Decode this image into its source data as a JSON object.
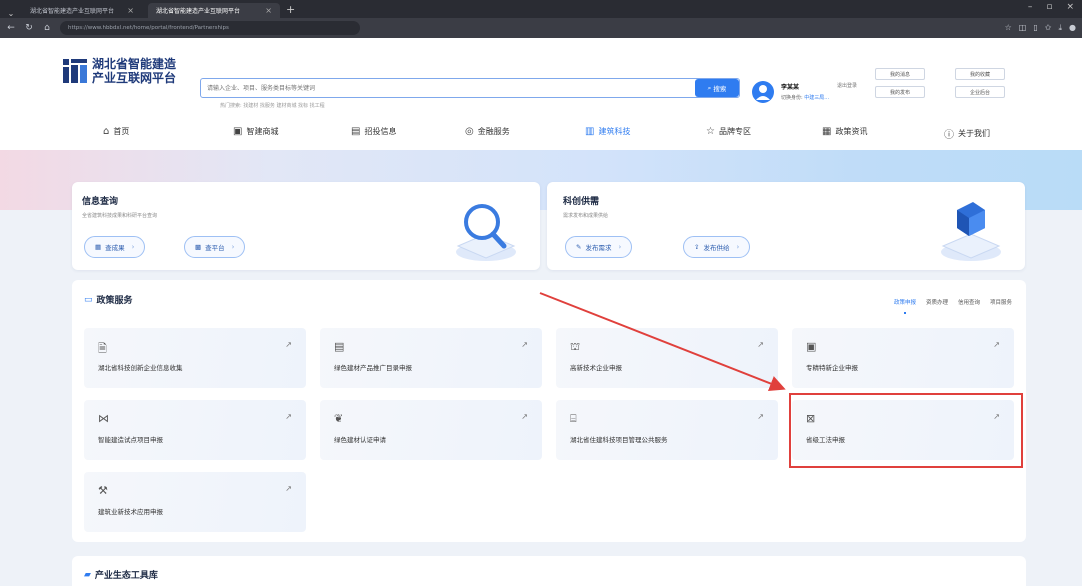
{
  "browser": {
    "tabs": [
      {
        "title": "湖北省智能建造产业互联网平台",
        "active": false
      },
      {
        "title": "湖北省智能建造产业互联网平台",
        "active": true
      }
    ],
    "new_tab": "+",
    "url": "https://www.hbbdxl.net/home/portal/frontend/Partnerships"
  },
  "site": {
    "logo_line1": "湖北省智能建造",
    "logo_line2": "产业互联网平台",
    "search_placeholder": "请输入企业、项目、服务类目标等关键词",
    "search_button": "搜索",
    "hot_words": "热门搜索: 找建材  找服务  建材商城  找标  找工程",
    "user": {
      "name": "李某某",
      "link": "退出登录",
      "role_prefix": "切换身份: ",
      "role_value": "中建三局..."
    },
    "quick_buttons": [
      "我的消息",
      "我的收藏",
      "我的发布",
      "企业后台"
    ],
    "nav": [
      {
        "label": "首页",
        "icon": "home-icon",
        "active": false
      },
      {
        "label": "智建商城",
        "icon": "shop-icon",
        "active": false
      },
      {
        "label": "招投信息",
        "icon": "bid-icon",
        "active": false
      },
      {
        "label": "金融服务",
        "icon": "finance-icon",
        "active": false
      },
      {
        "label": "建筑科技",
        "icon": "tech-icon",
        "active": true
      },
      {
        "label": "品牌专区",
        "icon": "star-icon",
        "active": false
      },
      {
        "label": "政策资讯",
        "icon": "news-icon",
        "active": false
      },
      {
        "label": "关于我们",
        "icon": "info-icon",
        "active": false
      }
    ]
  },
  "info_card": {
    "title": "信息查询",
    "subtitle": "全省建筑科技成果和科研平台查询",
    "pills": [
      "查成果",
      "查平台"
    ]
  },
  "tech_card": {
    "title": "科创供需",
    "subtitle": "需求发布和成果供给",
    "pills": [
      "发布需求",
      "发布供给"
    ]
  },
  "policy": {
    "title": "政策服务",
    "tabs": [
      "政策申报",
      "资质办理",
      "信用查询",
      "项目服务"
    ],
    "items": [
      {
        "label": "湖北省科技创新企业信息收集",
        "icon": "document-icon"
      },
      {
        "label": "绿色建材产品推广目录申报",
        "icon": "list-icon"
      },
      {
        "label": "高新技术企业申报",
        "icon": "building-icon"
      },
      {
        "label": "专精特新企业申报",
        "icon": "certificate-icon"
      },
      {
        "label": "智能建造试点项目申报",
        "icon": "network-icon"
      },
      {
        "label": "绿色建材认证申请",
        "icon": "leaf-icon"
      },
      {
        "label": "湖北省住建科技项目管理公共服务",
        "icon": "bank-icon"
      },
      {
        "label": "省级工法申报",
        "icon": "form-icon"
      },
      {
        "label": "建筑业新技术应用申报",
        "icon": "tools-icon"
      }
    ],
    "arrow": "↗",
    "highlight_color": "#e0403c"
  },
  "ecosystem": {
    "title": "产业生态工具库"
  },
  "colors": {
    "accent": "#2f7cf0",
    "annotation": "#e0403c"
  }
}
